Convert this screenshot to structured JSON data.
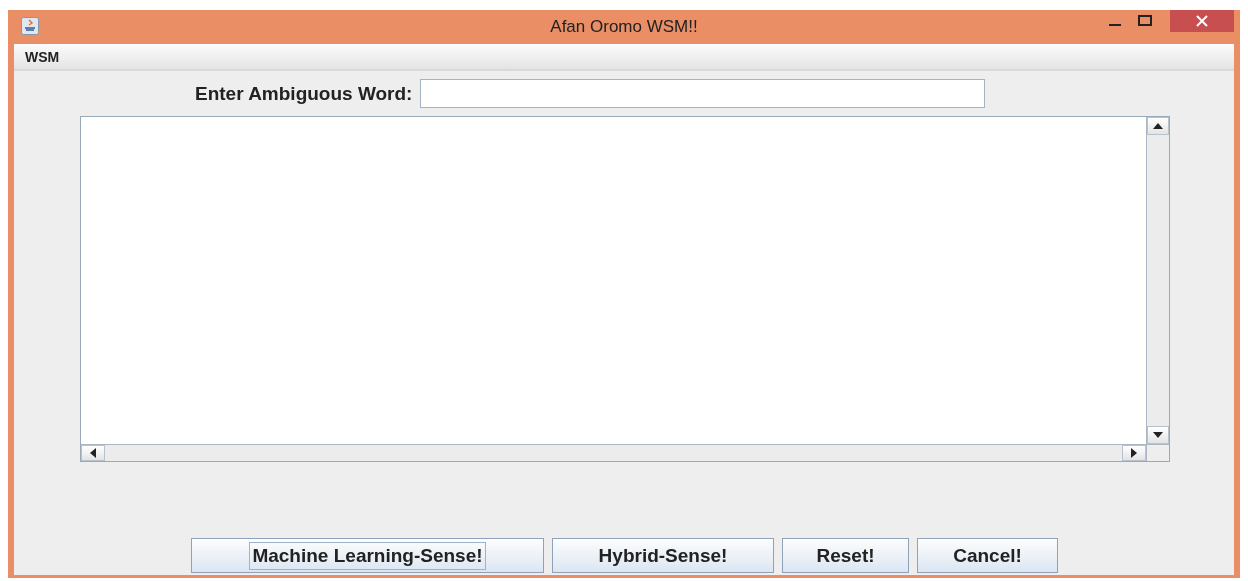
{
  "window": {
    "title": "Afan Oromo WSM!!"
  },
  "menu": [
    {
      "label": "WSM"
    }
  ],
  "word_field": {
    "label": "Enter Ambiguous Word:"
  },
  "buttons": [
    {
      "label": "Machine Learning-Sense!",
      "focused": true
    },
    {
      "label": "Hybrid-Sense!",
      "focused": false
    },
    {
      "label": "Reset!",
      "focused": false
    },
    {
      "label": "Cancel!",
      "focused": false
    }
  ]
}
